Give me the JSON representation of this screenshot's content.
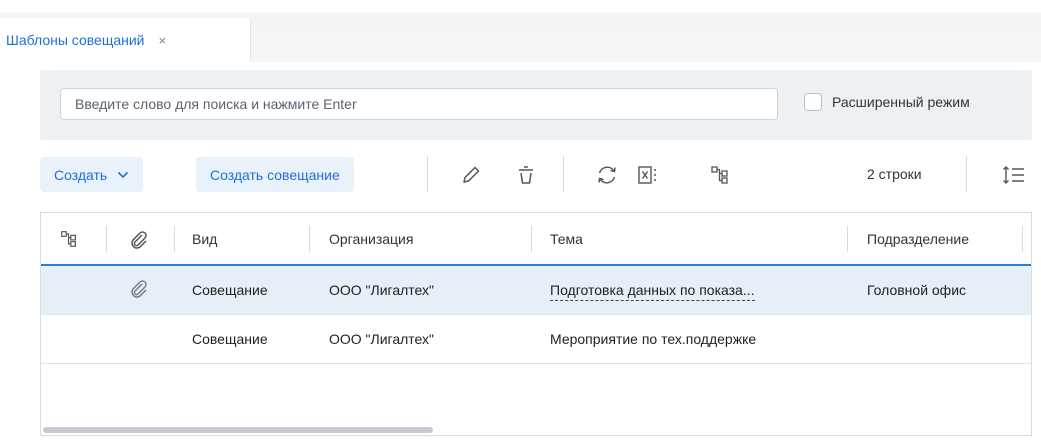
{
  "tab": {
    "title": "Шаблоны совещаний",
    "close": "×"
  },
  "search": {
    "placeholder": "Введите слово для поиска и нажмите Enter",
    "value": ""
  },
  "advanced": {
    "label": "Расширенный режим",
    "checked": false
  },
  "toolbar": {
    "create_label": "Создать",
    "create_meeting_label": "Создать совещание",
    "rows_count": "2 строки"
  },
  "grid": {
    "columns": [
      "Вид",
      "Организация",
      "Тема",
      "Подразделение"
    ],
    "rows": [
      {
        "has_attachment": true,
        "selected": true,
        "vid": "Совещание",
        "org": "ООО \"Лигалтех\"",
        "tema": "Подготовка данных по показа...",
        "podr": "Головной офис"
      },
      {
        "has_attachment": false,
        "selected": false,
        "vid": "Совещание",
        "org": "ООО \"Лигалтех\"",
        "tema": "Мероприятие по тех.поддержке",
        "podr": ""
      }
    ]
  },
  "colors": {
    "accent": "#1f6fd6",
    "selected_row": "#e6eef8",
    "button_bg": "#e9f1fb"
  }
}
